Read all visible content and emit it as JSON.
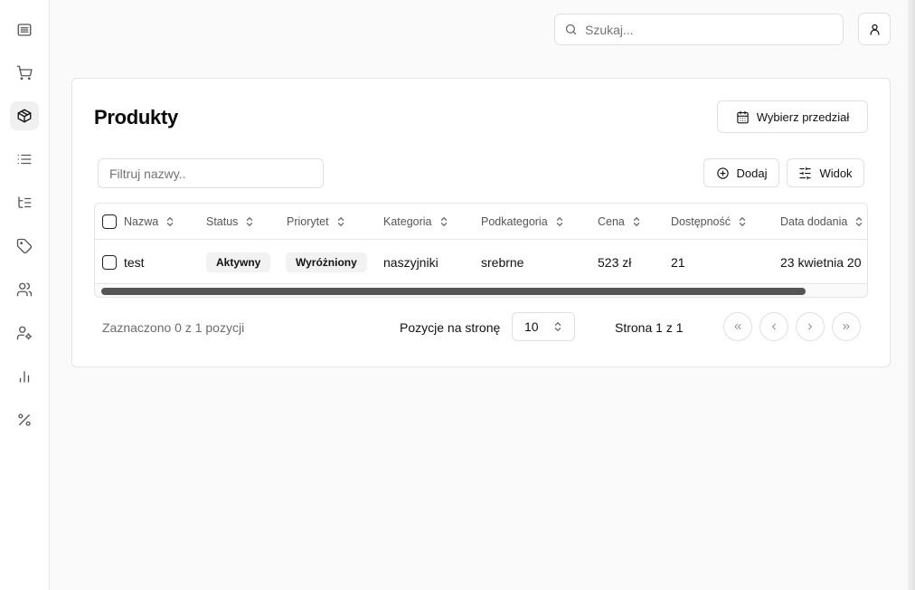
{
  "sidebar": {
    "items": [
      {
        "name": "dashboard",
        "icon": "layers-icon",
        "active": false
      },
      {
        "name": "orders",
        "icon": "cart-icon",
        "active": false
      },
      {
        "name": "products",
        "icon": "box-icon",
        "active": true
      },
      {
        "name": "list",
        "icon": "list-icon",
        "active": false
      },
      {
        "name": "categories",
        "icon": "tree-list-icon",
        "active": false
      },
      {
        "name": "tags",
        "icon": "tag-icon",
        "active": false
      },
      {
        "name": "customers",
        "icon": "users-icon",
        "active": false
      },
      {
        "name": "user-settings",
        "icon": "user-cog-icon",
        "active": false
      },
      {
        "name": "statistics",
        "icon": "bar-chart-icon",
        "active": false
      },
      {
        "name": "discounts",
        "icon": "percent-icon",
        "active": false
      }
    ]
  },
  "topbar": {
    "search_placeholder": "Szukaj..."
  },
  "main": {
    "title": "Produkty",
    "date_button": "Wybierz przedział",
    "filter_placeholder": "Filtruj nazwy..",
    "add_button": "Dodaj",
    "view_button": "Widok"
  },
  "table": {
    "columns": [
      "Nazwa",
      "Status",
      "Priorytet",
      "Kategoria",
      "Podkategoria",
      "Cena",
      "Dostępność",
      "Data dodania"
    ],
    "rows": [
      {
        "name": "test",
        "status": "Aktywny",
        "priority": "Wyróżniony",
        "category": "naszyjniki",
        "subcategory": "srebrne",
        "price": "523 zł",
        "availability": "21",
        "date_added": "23 kwietnia 20"
      }
    ]
  },
  "footer": {
    "selected_text": "Zaznaczono 0 z 1 pozycji",
    "rows_per_page_label": "Pozycje na stronę",
    "rows_per_page_value": "10",
    "page_info": "Strona 1 z 1"
  },
  "colors": {
    "background": "#fafafa",
    "card": "#ffffff",
    "border": "#e5e5e5",
    "badge_bg": "#f2f2f2",
    "muted_text": "#737373"
  }
}
